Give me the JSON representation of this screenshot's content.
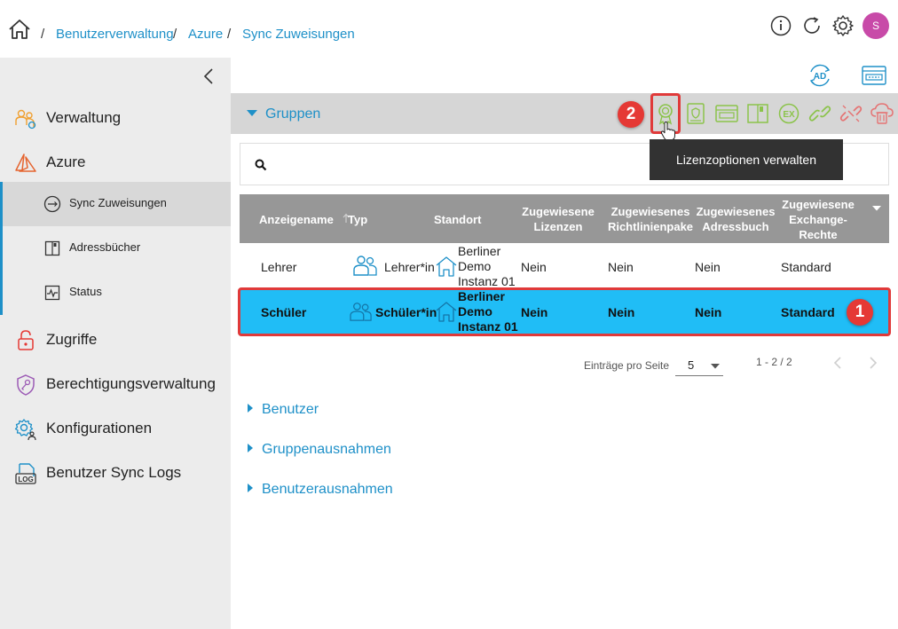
{
  "breadcrumb": {
    "separator": "/",
    "items": [
      "Benutzerverwaltung",
      "Azure",
      "Sync Zuweisungen"
    ]
  },
  "header_icons": [
    "home-icon",
    "info-icon",
    "refresh-icon",
    "settings-icon"
  ],
  "user": {
    "avatar_initial": "S",
    "avatar_color": "#c84aa8"
  },
  "sidebar": {
    "main_items": [
      {
        "label": "Verwaltung",
        "icon": "people-icon"
      },
      {
        "label": "Azure",
        "icon": "azure-icon"
      },
      {
        "label": "Zugriffe",
        "icon": "lock-icon"
      },
      {
        "label": "Berechtigungsverwaltung",
        "icon": "shield-key-icon"
      },
      {
        "label": "Konfigurationen",
        "icon": "gear-people-icon"
      },
      {
        "label": "Benutzer Sync Logs",
        "icon": "log-icon"
      }
    ],
    "sub_items": [
      {
        "label": "Sync Zuweisungen",
        "icon": "sync-icon"
      },
      {
        "label": "Adressbücher",
        "icon": "addressbook-icon"
      },
      {
        "label": "Status",
        "icon": "status-icon"
      }
    ]
  },
  "groups_section": {
    "title": "Gruppen",
    "tooltip": "Lizenzoptionen verwalten",
    "toolbar_icons": [
      "license-icon",
      "policy-icon",
      "addressbook-grid-icon",
      "book-icon",
      "exchange-icon",
      "link-icon",
      "unlink-icon",
      "cloud-delete-icon"
    ]
  },
  "search": {
    "placeholder": ""
  },
  "table": {
    "columns": [
      "Anzeigename",
      "Typ",
      "Standort",
      "Zugewiesene Lizenzen",
      "Zugewiesenes Richtlinienpaket",
      "Zugewiesenes Adressbuch",
      "Zugewiesene Exchange-Rechte"
    ],
    "column_display": [
      "Anzeigename",
      "Typ",
      "Standort",
      "Zugewiesene\nLizenzen",
      "Zugewiesenes\nRichtlinienpake",
      "Zugewiesenes\nAdressbuch",
      "Zugewiesene\nExchange-\nRechte"
    ],
    "rows": [
      {
        "name": "Lehrer",
        "type": "Lehrer*in",
        "location_lines": [
          "Berliner",
          "Demo",
          "Instanz 01"
        ],
        "licenses": "Nein",
        "policy": "Nein",
        "addressbook": "Nein",
        "exchange": "Standard",
        "selected": false
      },
      {
        "name": "Schüler",
        "type": "Schüler*in",
        "location_lines": [
          "Berliner",
          "Demo",
          "Instanz 01"
        ],
        "licenses": "Nein",
        "policy": "Nein",
        "addressbook": "Nein",
        "exchange": "Standard",
        "selected": true
      }
    ]
  },
  "pagination": {
    "label": "Einträge pro Seite",
    "page_size": "5",
    "range": "1 - 2 / 2"
  },
  "sections": [
    "Benutzer",
    "Gruppenausnahmen",
    "Benutzerausnahmen"
  ],
  "annotations": {
    "badge_1": "1",
    "badge_2": "2"
  },
  "colors": {
    "accent": "#1e90c8",
    "selected_row": "#20bdf6",
    "highlight": "#e03a3a",
    "icon_green": "#8bc34a",
    "icon_red": "#e57373",
    "header_gray": "#979797"
  },
  "top_toolbar_icons": [
    "ad-sync-icon",
    "console-icon"
  ]
}
